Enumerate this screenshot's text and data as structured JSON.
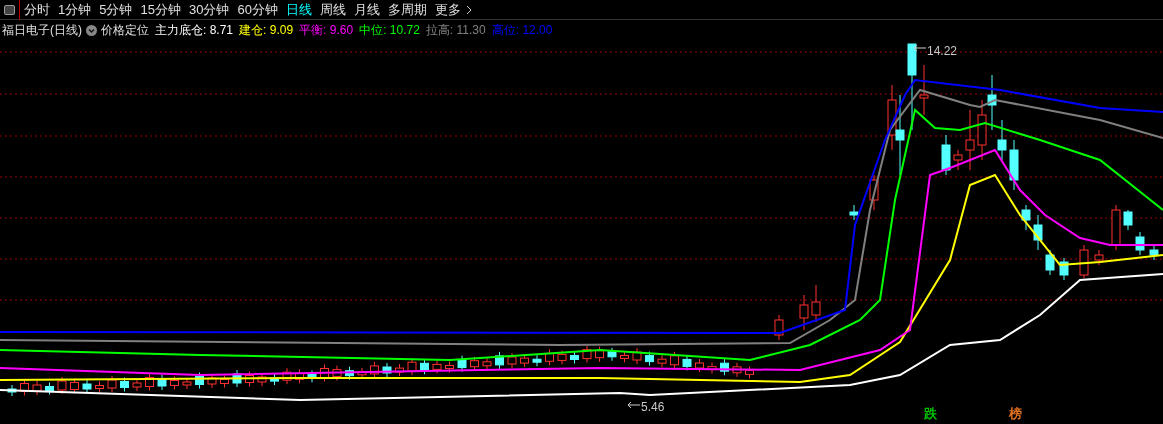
{
  "toolbar": {
    "tabs": [
      {
        "label": "分时",
        "selected": false
      },
      {
        "label": "1分钟",
        "selected": false
      },
      {
        "label": "5分钟",
        "selected": false
      },
      {
        "label": "15分钟",
        "selected": false
      },
      {
        "label": "30分钟",
        "selected": false
      },
      {
        "label": "60分钟",
        "selected": false
      },
      {
        "label": "日线",
        "selected": true
      },
      {
        "label": "周线",
        "selected": false
      },
      {
        "label": "月线",
        "selected": false
      },
      {
        "label": "多周期",
        "selected": false
      },
      {
        "label": "更多",
        "selected": false
      }
    ]
  },
  "legend": {
    "title": "福日电子(日线)",
    "indicator": "价格定位",
    "items": [
      {
        "label": "主力底仓:",
        "value": "8.71",
        "color": "#ffffff"
      },
      {
        "label": "建仓:",
        "value": "9.09",
        "color": "#ffff00"
      },
      {
        "label": "平衡:",
        "value": "9.60",
        "color": "#ff00ff"
      },
      {
        "label": "中位:",
        "value": "10.72",
        "color": "#00ff00"
      },
      {
        "label": "拉高:",
        "value": "11.30",
        "color": "#808080"
      },
      {
        "label": "高位:",
        "value": "12.00",
        "color": "#0000ff"
      }
    ]
  },
  "chart": {
    "high_label": "14.22",
    "low_label": "5.46",
    "markers": [
      {
        "text": "跌",
        "color": "#00c000"
      },
      {
        "text": "榜",
        "color": "#e07020"
      }
    ]
  }
}
